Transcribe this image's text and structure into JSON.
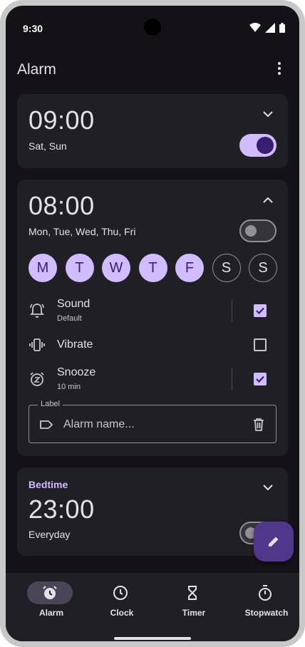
{
  "status_bar": {
    "time": "9:30"
  },
  "app_bar": {
    "title": "Alarm"
  },
  "alarms": [
    {
      "time": "09:00",
      "days": "Sat, Sun",
      "enabled": true
    },
    {
      "time": "08:00",
      "days": "Mon, Tue, Wed, Thu, Fri",
      "enabled": false,
      "day_chips": [
        {
          "letter": "M",
          "selected": true
        },
        {
          "letter": "T",
          "selected": true
        },
        {
          "letter": "W",
          "selected": true
        },
        {
          "letter": "T",
          "selected": true
        },
        {
          "letter": "F",
          "selected": true
        },
        {
          "letter": "S",
          "selected": false
        },
        {
          "letter": "S",
          "selected": false
        }
      ],
      "options": {
        "sound": {
          "label": "Sound",
          "sub": "Default",
          "checked": true
        },
        "vibrate": {
          "label": "Vibrate",
          "checked": false
        },
        "snooze": {
          "label": "Snooze",
          "sub": "10 min",
          "checked": true
        }
      },
      "label_field": {
        "floating_label": "Label",
        "placeholder": "Alarm name..."
      }
    },
    {
      "tag": "Bedtime",
      "time": "23:00",
      "days": "Everyday",
      "enabled": false
    }
  ],
  "nav": [
    {
      "label": "Alarm",
      "icon": "alarm-icon",
      "active": true
    },
    {
      "label": "Clock",
      "icon": "clock-icon",
      "active": false
    },
    {
      "label": "Timer",
      "icon": "hourglass-icon",
      "active": false
    },
    {
      "label": "Stopwatch",
      "icon": "stopwatch-icon",
      "active": false
    }
  ],
  "colors": {
    "background": "#141218",
    "surface": "#211f26",
    "primary": "#d0bcff",
    "on_primary": "#381e72",
    "fab": "#4f378b"
  }
}
